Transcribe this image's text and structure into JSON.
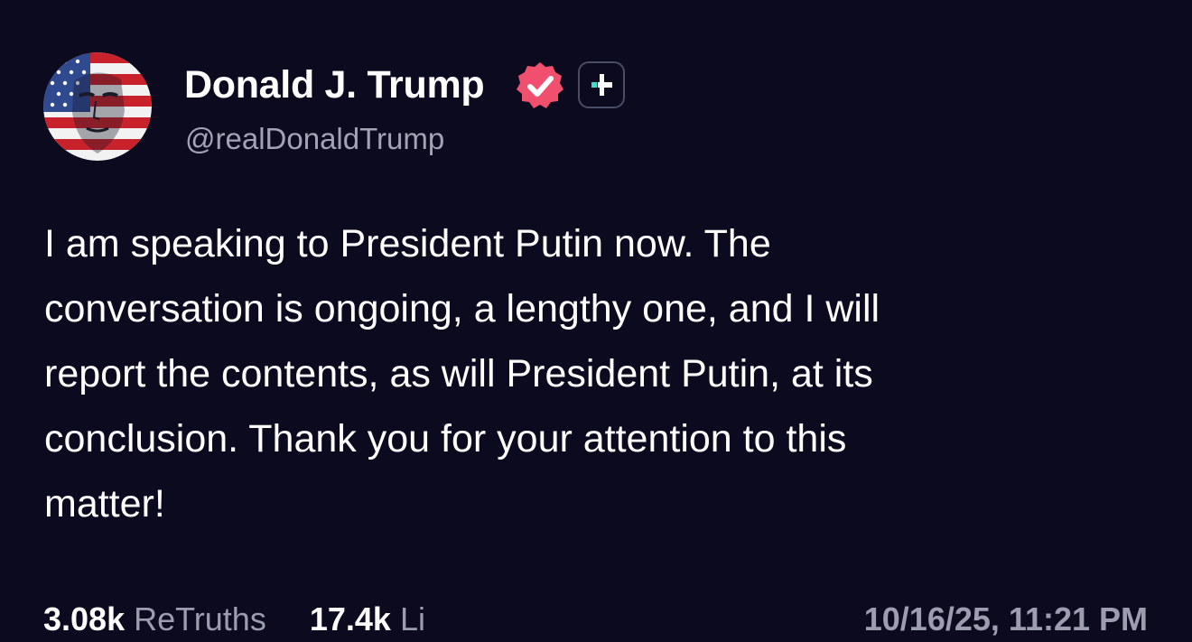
{
  "colors": {
    "background": "#0b0a1e",
    "text": "#ffffff",
    "muted": "#9d9db0",
    "verified": "#f0506e",
    "plus_accent": "#3ee0c8"
  },
  "author": {
    "display_name": "Donald J. Trump",
    "handle": "@realDonaldTrump",
    "avatar_icon": "flag-portrait-avatar",
    "verified_icon": "verified-badge-icon",
    "plus_icon": "plus-badge-icon"
  },
  "post": {
    "text": "I am speaking to President Putin now. The\nconversation is ongoing, a lengthy one, and I will\nreport the contents, as will President Putin, at its\nconclusion. Thank you for your attention to this\nmatter!"
  },
  "stats": {
    "retruths_count": "3.08k",
    "retruths_label": "ReTruths",
    "likes_count": "17.4k",
    "likes_label": "Li"
  },
  "timestamp": "10/16/25, 11:21 PM"
}
